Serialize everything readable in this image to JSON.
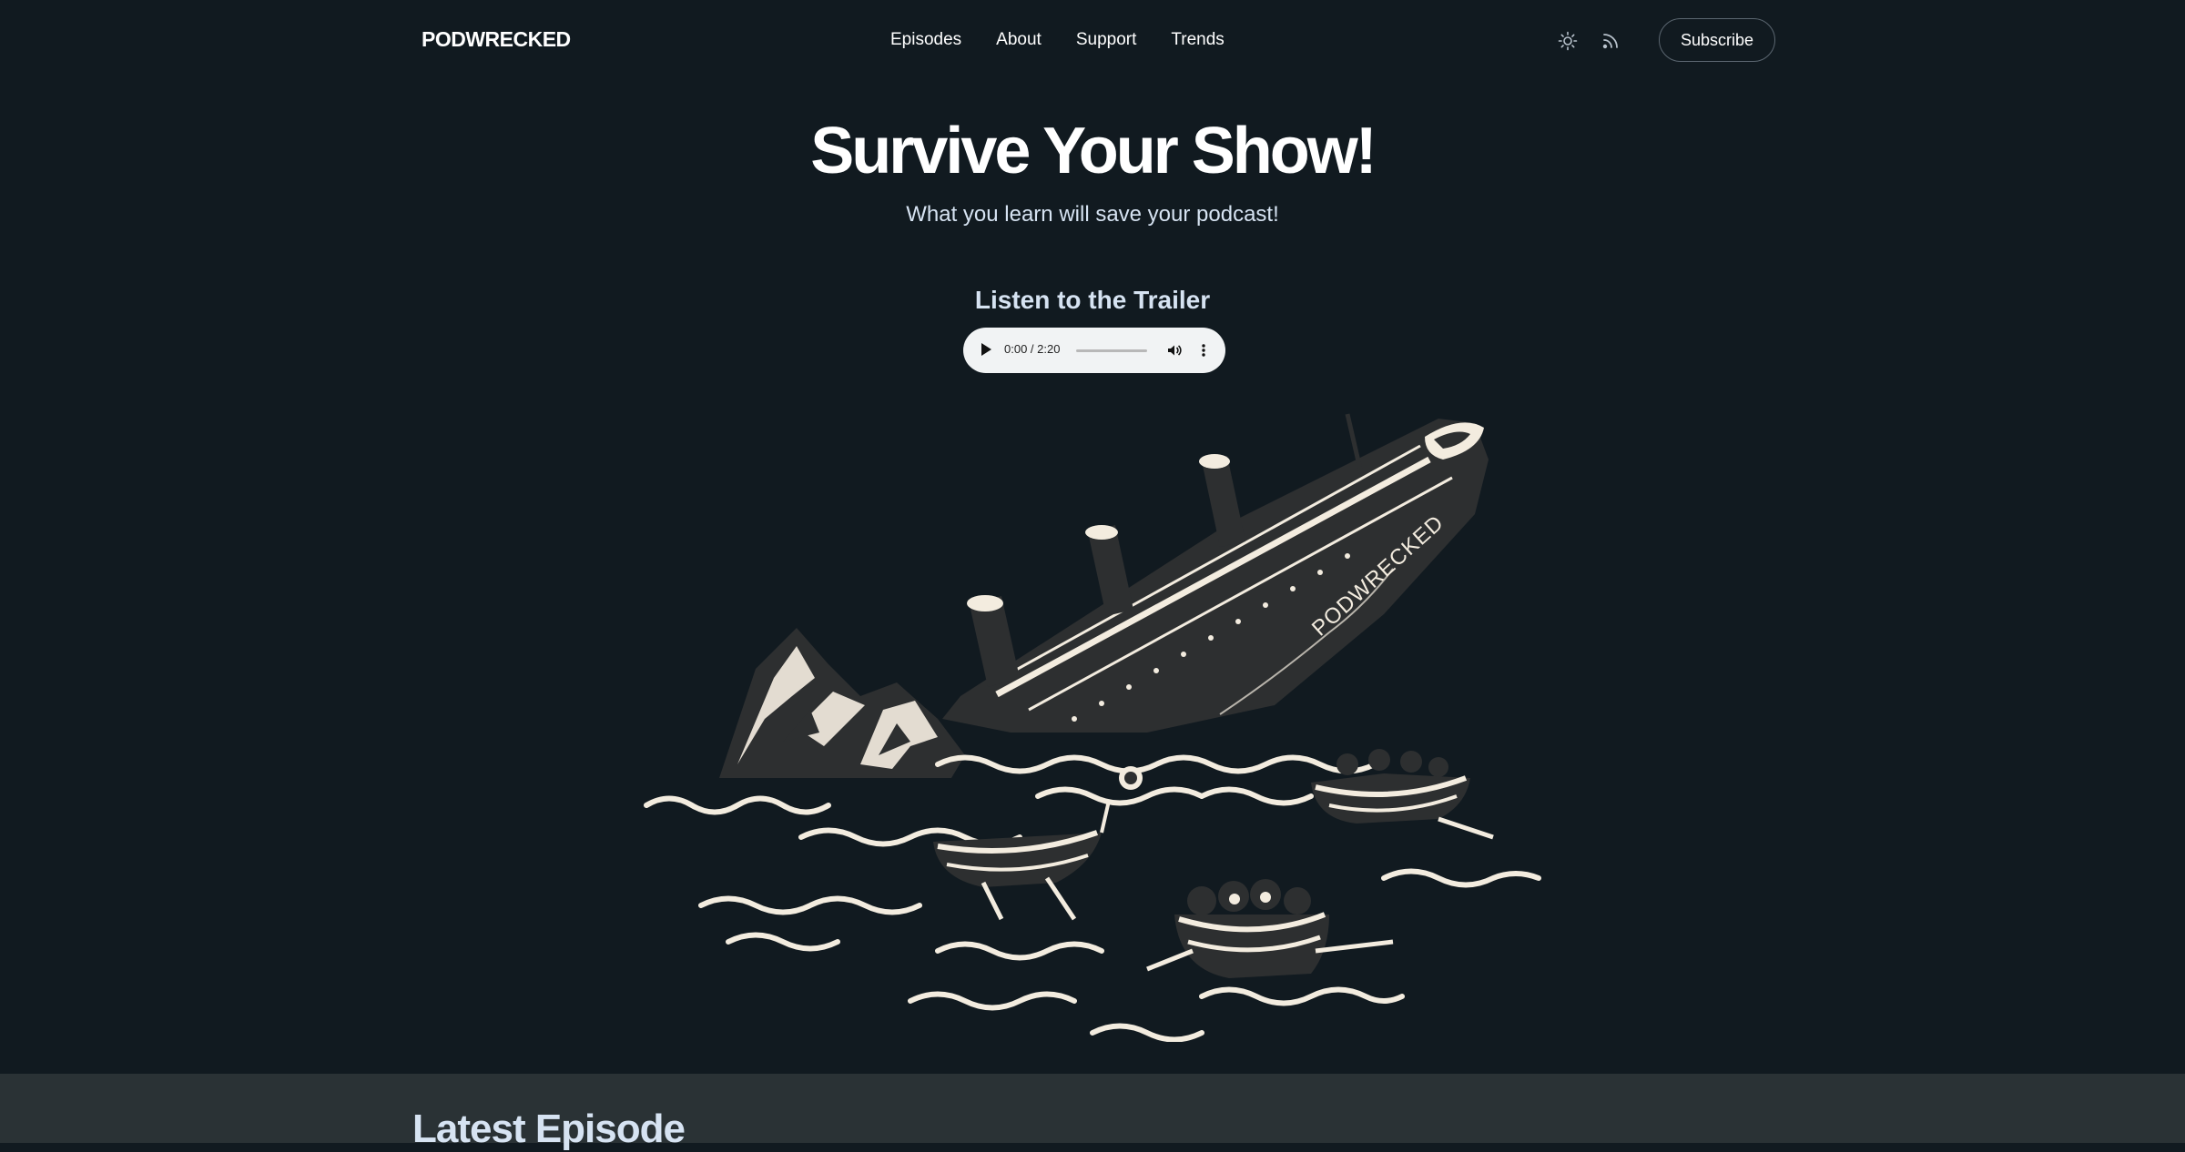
{
  "brand": {
    "name": "PODWRECKED"
  },
  "nav": {
    "items": [
      {
        "label": "Episodes"
      },
      {
        "label": "About"
      },
      {
        "label": "Support"
      },
      {
        "label": "Trends"
      }
    ],
    "theme_icon": "sun-icon",
    "rss_icon": "rss-icon",
    "subscribe_label": "Subscribe"
  },
  "hero": {
    "title": "Survive Your Show!",
    "subtitle": "What you learn will save your podcast!"
  },
  "trailer": {
    "heading": "Listen to the Trailer",
    "time": "0:00 / 2:20",
    "progress": 0,
    "play_icon": "play-icon",
    "volume_icon": "volume-icon",
    "more_icon": "more-options-icon"
  },
  "illustration": {
    "ship_name": "PODWRECKED",
    "colors": {
      "ink": "#2d2f30",
      "cream": "#f3ecdf"
    }
  },
  "latest": {
    "heading": "Latest Episode"
  },
  "colors": {
    "background": "#111a20",
    "section_bg": "#2a3235",
    "accent_text": "#d6e3f2"
  }
}
